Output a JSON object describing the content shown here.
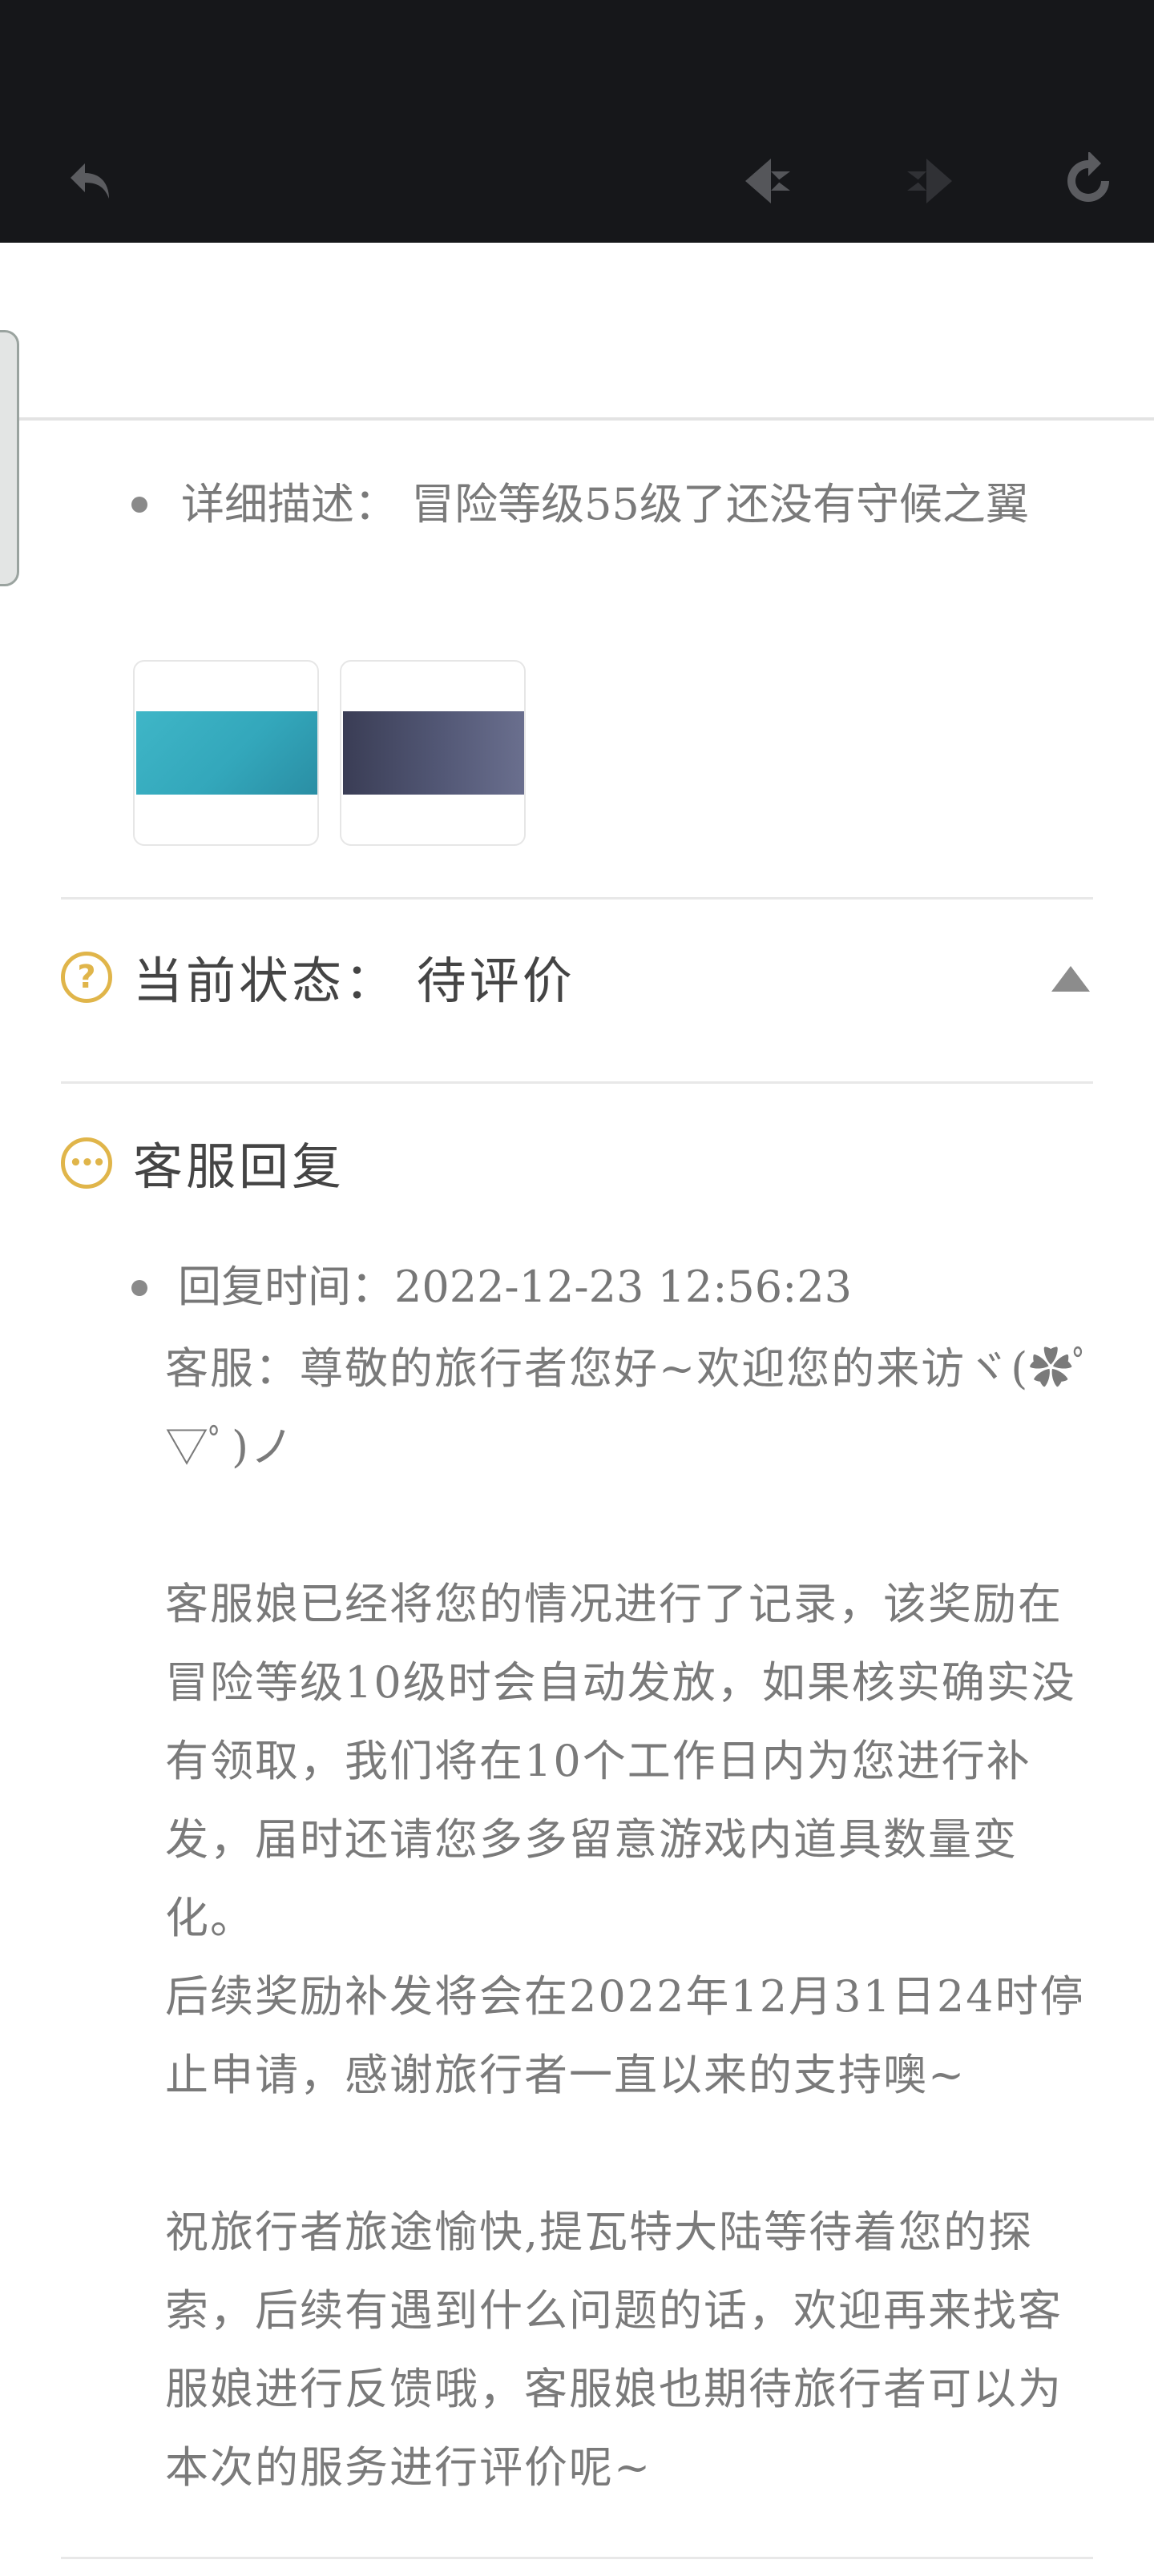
{
  "toolbar": {
    "back": "back-arrow-icon",
    "prev": "prev-icon",
    "next": "next-icon",
    "refresh": "refresh-icon"
  },
  "detail": {
    "label": "详细描述：",
    "value": "冒险等级55级了还没有守候之翼"
  },
  "thumbnails": [
    {
      "name": "screenshot-1"
    },
    {
      "name": "screenshot-2"
    }
  ],
  "status": {
    "label": "当前状态：",
    "value": "待评价"
  },
  "reply": {
    "title": "客服回复",
    "time_label": "回复时间：",
    "time_value": "2022-12-23 12:56:23",
    "line1": "客服：尊敬的旅行者您好~欢迎您的来访ヾ(✿ﾟ▽ﾟ)ノ",
    "para1": "客服娘已经将您的情况进行了记录，该奖励在冒险等级10级时会自动发放，如果核实确实没有领取，我们将在10个工作日内为您进行补发，届时还请您多多留意游戏内道具数量变化。",
    "para2": "后续奖励补发将会在2022年12月31日24时停止申请，感谢旅行者一直以来的支持噢~",
    "para3": "祝旅行者旅途愉快,提瓦特大陆等待着您的探索，后续有遇到什么问题的话，欢迎再来找客服娘进行反馈哦，客服娘也期待旅行者可以为本次的服务进行评价呢~"
  },
  "colors": {
    "toolbar_bg": "#16171a",
    "accent": "#e0b54a",
    "text": "#7a7a7a"
  }
}
